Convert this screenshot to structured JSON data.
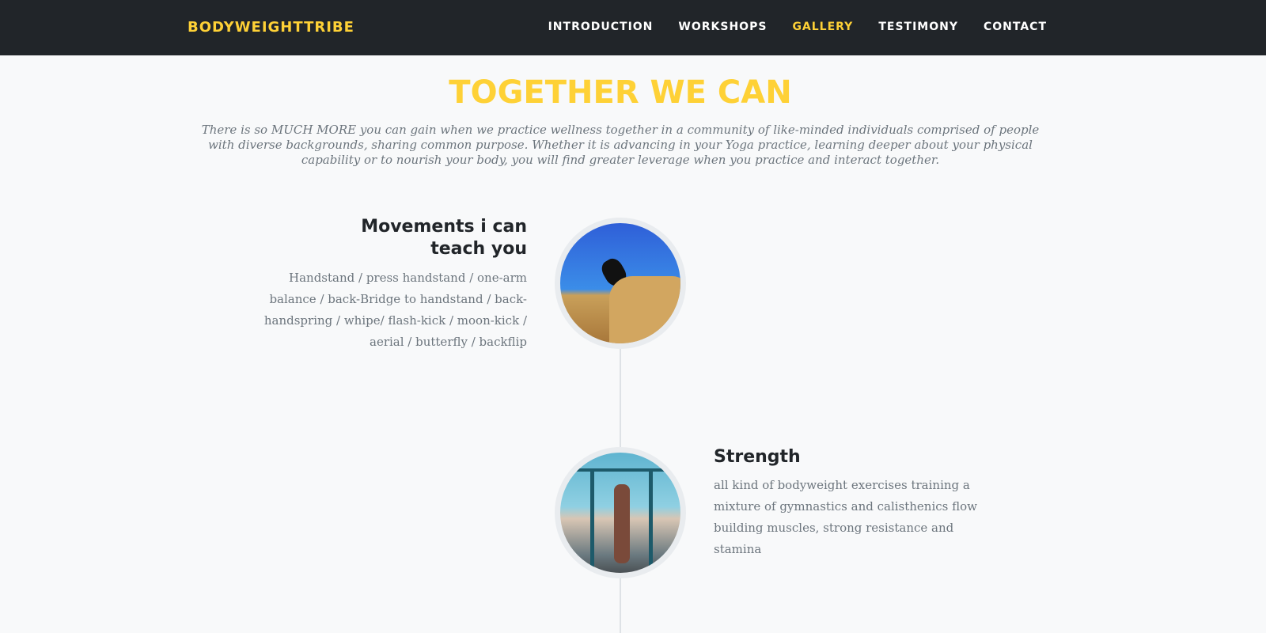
{
  "nav": {
    "brand": "BODYWEIGHTTRIBE",
    "items": [
      "INTRODUCTION",
      "WORKSHOPS",
      "GALLERY",
      "TESTIMONY",
      "CONTACT"
    ],
    "active": "GALLERY"
  },
  "section": {
    "title": "TOGETHER WE CAN",
    "lead": "There is so MUCH MORE you can gain when we practice wellness together in a community of like-minded individuals comprised of people with diverse backgrounds, sharing common purpose. Whether it is advancing in your Yoga practice, learning deeper about your physical capability or to nourish your body, you will find greater leverage when you practice and interact together."
  },
  "timeline": [
    {
      "heading": "Movements i can teach you",
      "text": "Handstand / press handstand / one-arm balance / back-Bridge to handstand / back-handspring / whipe/ flash-kick / moon-kick / aerial / butterfly / backflip"
    },
    {
      "heading": "Strength",
      "text": "all kind of bodyweight exercises training a mixture of gymnastics and calisthenics flow building muscles, strong resistance and stamina"
    }
  ],
  "colors": {
    "accent": "#fed136",
    "nav_bg": "#212529"
  }
}
